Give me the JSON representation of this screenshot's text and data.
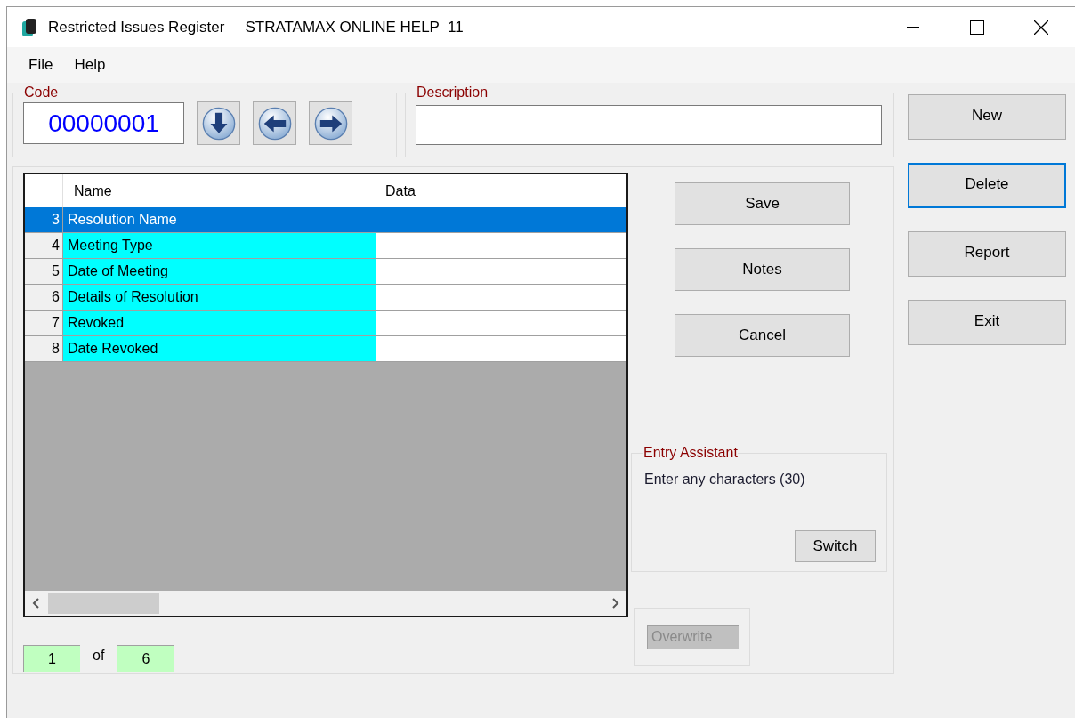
{
  "window": {
    "title": "Restricted Issues Register",
    "subtitle": "STRATAMAX ONLINE HELP  11"
  },
  "menu": [
    "File",
    "Help"
  ],
  "code": {
    "label": "Code",
    "value": "00000001"
  },
  "description": {
    "label": "Description"
  },
  "grid": {
    "columns": [
      "Name",
      "Data"
    ],
    "rows": [
      {
        "number": "3",
        "name": "Resolution Name",
        "selected": true
      },
      {
        "number": "4",
        "name": "Meeting Type",
        "selected": false
      },
      {
        "number": "5",
        "name": "Date of Meeting",
        "selected": false
      },
      {
        "number": "6",
        "name": "Details of Resolution",
        "selected": false
      },
      {
        "number": "7",
        "name": "Revoked",
        "selected": false
      },
      {
        "number": "8",
        "name": "Date Revoked",
        "selected": false
      }
    ]
  },
  "actions": [
    "Save",
    "Notes",
    "Cancel"
  ],
  "entry_assistant": {
    "label": "Entry Assistant",
    "hint": "Enter any characters (30)",
    "button": "Switch"
  },
  "overwrite": {
    "label": "Overwrite",
    "disabled": true
  },
  "pager": {
    "current": "1",
    "of": "of",
    "total": "6"
  },
  "side_buttons": [
    {
      "label": "New",
      "focused": false
    },
    {
      "label": "Delete",
      "focused": true
    },
    {
      "label": "Report",
      "focused": false
    },
    {
      "label": "Exit",
      "focused": false
    }
  ]
}
